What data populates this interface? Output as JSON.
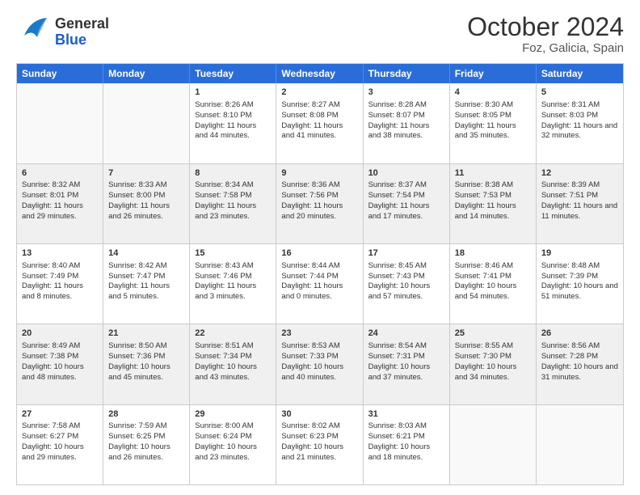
{
  "header": {
    "logo_general": "General",
    "logo_blue": "Blue",
    "title": "October 2024",
    "location": "Foz, Galicia, Spain"
  },
  "calendar": {
    "days": [
      "Sunday",
      "Monday",
      "Tuesday",
      "Wednesday",
      "Thursday",
      "Friday",
      "Saturday"
    ],
    "rows": [
      [
        {
          "day": "",
          "sunrise": "",
          "sunset": "",
          "daylight": "",
          "empty": true
        },
        {
          "day": "",
          "sunrise": "",
          "sunset": "",
          "daylight": "",
          "empty": true
        },
        {
          "day": "1",
          "sunrise": "Sunrise: 8:26 AM",
          "sunset": "Sunset: 8:10 PM",
          "daylight": "Daylight: 11 hours and 44 minutes."
        },
        {
          "day": "2",
          "sunrise": "Sunrise: 8:27 AM",
          "sunset": "Sunset: 8:08 PM",
          "daylight": "Daylight: 11 hours and 41 minutes."
        },
        {
          "day": "3",
          "sunrise": "Sunrise: 8:28 AM",
          "sunset": "Sunset: 8:07 PM",
          "daylight": "Daylight: 11 hours and 38 minutes."
        },
        {
          "day": "4",
          "sunrise": "Sunrise: 8:30 AM",
          "sunset": "Sunset: 8:05 PM",
          "daylight": "Daylight: 11 hours and 35 minutes."
        },
        {
          "day": "5",
          "sunrise": "Sunrise: 8:31 AM",
          "sunset": "Sunset: 8:03 PM",
          "daylight": "Daylight: 11 hours and 32 minutes."
        }
      ],
      [
        {
          "day": "6",
          "sunrise": "Sunrise: 8:32 AM",
          "sunset": "Sunset: 8:01 PM",
          "daylight": "Daylight: 11 hours and 29 minutes."
        },
        {
          "day": "7",
          "sunrise": "Sunrise: 8:33 AM",
          "sunset": "Sunset: 8:00 PM",
          "daylight": "Daylight: 11 hours and 26 minutes."
        },
        {
          "day": "8",
          "sunrise": "Sunrise: 8:34 AM",
          "sunset": "Sunset: 7:58 PM",
          "daylight": "Daylight: 11 hours and 23 minutes."
        },
        {
          "day": "9",
          "sunrise": "Sunrise: 8:36 AM",
          "sunset": "Sunset: 7:56 PM",
          "daylight": "Daylight: 11 hours and 20 minutes."
        },
        {
          "day": "10",
          "sunrise": "Sunrise: 8:37 AM",
          "sunset": "Sunset: 7:54 PM",
          "daylight": "Daylight: 11 hours and 17 minutes."
        },
        {
          "day": "11",
          "sunrise": "Sunrise: 8:38 AM",
          "sunset": "Sunset: 7:53 PM",
          "daylight": "Daylight: 11 hours and 14 minutes."
        },
        {
          "day": "12",
          "sunrise": "Sunrise: 8:39 AM",
          "sunset": "Sunset: 7:51 PM",
          "daylight": "Daylight: 11 hours and 11 minutes."
        }
      ],
      [
        {
          "day": "13",
          "sunrise": "Sunrise: 8:40 AM",
          "sunset": "Sunset: 7:49 PM",
          "daylight": "Daylight: 11 hours and 8 minutes."
        },
        {
          "day": "14",
          "sunrise": "Sunrise: 8:42 AM",
          "sunset": "Sunset: 7:47 PM",
          "daylight": "Daylight: 11 hours and 5 minutes."
        },
        {
          "day": "15",
          "sunrise": "Sunrise: 8:43 AM",
          "sunset": "Sunset: 7:46 PM",
          "daylight": "Daylight: 11 hours and 3 minutes."
        },
        {
          "day": "16",
          "sunrise": "Sunrise: 8:44 AM",
          "sunset": "Sunset: 7:44 PM",
          "daylight": "Daylight: 11 hours and 0 minutes."
        },
        {
          "day": "17",
          "sunrise": "Sunrise: 8:45 AM",
          "sunset": "Sunset: 7:43 PM",
          "daylight": "Daylight: 10 hours and 57 minutes."
        },
        {
          "day": "18",
          "sunrise": "Sunrise: 8:46 AM",
          "sunset": "Sunset: 7:41 PM",
          "daylight": "Daylight: 10 hours and 54 minutes."
        },
        {
          "day": "19",
          "sunrise": "Sunrise: 8:48 AM",
          "sunset": "Sunset: 7:39 PM",
          "daylight": "Daylight: 10 hours and 51 minutes."
        }
      ],
      [
        {
          "day": "20",
          "sunrise": "Sunrise: 8:49 AM",
          "sunset": "Sunset: 7:38 PM",
          "daylight": "Daylight: 10 hours and 48 minutes."
        },
        {
          "day": "21",
          "sunrise": "Sunrise: 8:50 AM",
          "sunset": "Sunset: 7:36 PM",
          "daylight": "Daylight: 10 hours and 45 minutes."
        },
        {
          "day": "22",
          "sunrise": "Sunrise: 8:51 AM",
          "sunset": "Sunset: 7:34 PM",
          "daylight": "Daylight: 10 hours and 43 minutes."
        },
        {
          "day": "23",
          "sunrise": "Sunrise: 8:53 AM",
          "sunset": "Sunset: 7:33 PM",
          "daylight": "Daylight: 10 hours and 40 minutes."
        },
        {
          "day": "24",
          "sunrise": "Sunrise: 8:54 AM",
          "sunset": "Sunset: 7:31 PM",
          "daylight": "Daylight: 10 hours and 37 minutes."
        },
        {
          "day": "25",
          "sunrise": "Sunrise: 8:55 AM",
          "sunset": "Sunset: 7:30 PM",
          "daylight": "Daylight: 10 hours and 34 minutes."
        },
        {
          "day": "26",
          "sunrise": "Sunrise: 8:56 AM",
          "sunset": "Sunset: 7:28 PM",
          "daylight": "Daylight: 10 hours and 31 minutes."
        }
      ],
      [
        {
          "day": "27",
          "sunrise": "Sunrise: 7:58 AM",
          "sunset": "Sunset: 6:27 PM",
          "daylight": "Daylight: 10 hours and 29 minutes."
        },
        {
          "day": "28",
          "sunrise": "Sunrise: 7:59 AM",
          "sunset": "Sunset: 6:25 PM",
          "daylight": "Daylight: 10 hours and 26 minutes."
        },
        {
          "day": "29",
          "sunrise": "Sunrise: 8:00 AM",
          "sunset": "Sunset: 6:24 PM",
          "daylight": "Daylight: 10 hours and 23 minutes."
        },
        {
          "day": "30",
          "sunrise": "Sunrise: 8:02 AM",
          "sunset": "Sunset: 6:23 PM",
          "daylight": "Daylight: 10 hours and 21 minutes."
        },
        {
          "day": "31",
          "sunrise": "Sunrise: 8:03 AM",
          "sunset": "Sunset: 6:21 PM",
          "daylight": "Daylight: 10 hours and 18 minutes."
        },
        {
          "day": "",
          "sunrise": "",
          "sunset": "",
          "daylight": "",
          "empty": true
        },
        {
          "day": "",
          "sunrise": "",
          "sunset": "",
          "daylight": "",
          "empty": true
        }
      ]
    ]
  }
}
